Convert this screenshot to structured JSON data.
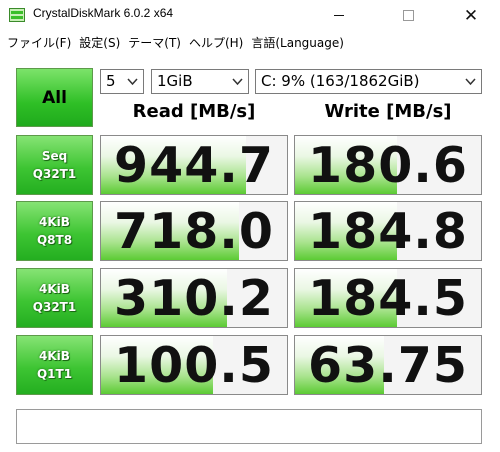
{
  "window": {
    "title": "CrystalDiskMark 6.0.2 x64",
    "controls": {
      "minimize": "",
      "maximize": "",
      "close": "✕"
    }
  },
  "menu": [
    "ファイル(F)",
    "設定(S)",
    "テーマ(T)",
    "ヘルプ(H)",
    "言語(Language)"
  ],
  "toolbar": {
    "all_label": "All",
    "test_count": "5",
    "test_size": "1GiB",
    "drive": "C: 9% (163/1862GiB)"
  },
  "headers": {
    "read": "Read [MB/s]",
    "write": "Write [MB/s]"
  },
  "rows": [
    {
      "label_line1": "Seq",
      "label_line2": "Q32T1",
      "read": "944.7",
      "write": "180.6",
      "read_fill": 0.78,
      "write_fill": 0.55
    },
    {
      "label_line1": "4KiB",
      "label_line2": "Q8T8",
      "read": "718.0",
      "write": "184.8",
      "read_fill": 0.74,
      "write_fill": 0.55
    },
    {
      "label_line1": "4KiB",
      "label_line2": "Q32T1",
      "read": "310.2",
      "write": "184.5",
      "read_fill": 0.68,
      "write_fill": 0.55
    },
    {
      "label_line1": "4KiB",
      "label_line2": "Q1T1",
      "read": "100.5",
      "write": "63.75",
      "read_fill": 0.6,
      "write_fill": 0.48
    }
  ],
  "comment": "",
  "colors": {
    "button_green": "#2fbf26",
    "bar_green": "#5ccb34"
  }
}
